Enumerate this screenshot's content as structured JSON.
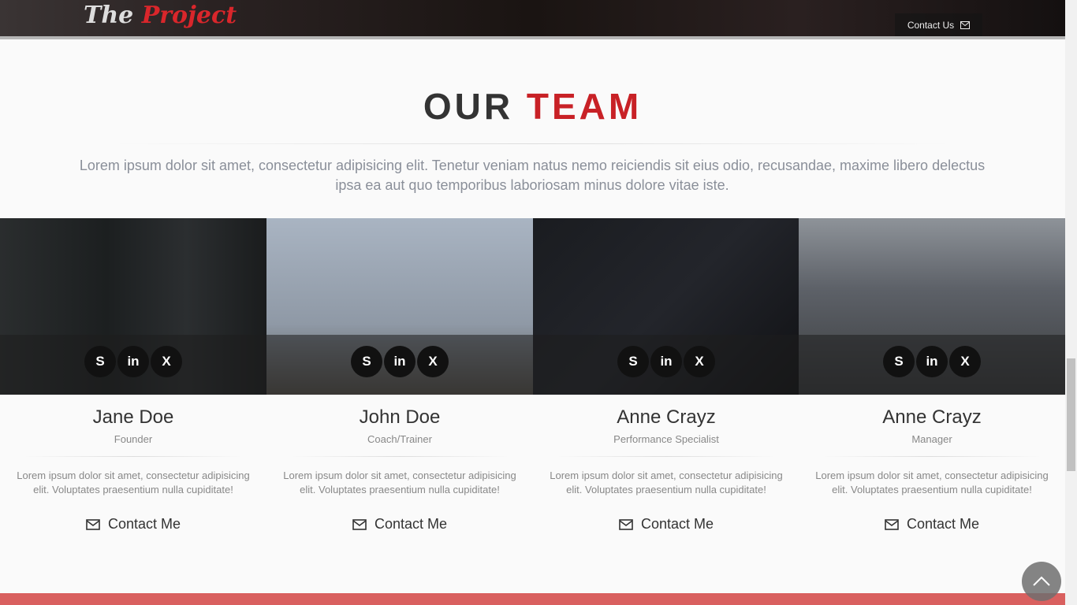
{
  "header": {
    "logo_part1": "The",
    "logo_part2": "Project",
    "contact_label": "Contact Us"
  },
  "section": {
    "title_part1": "OUR",
    "title_part2": "TEAM",
    "lead": "Lorem ipsum dolor sit amet, consectetur adipisicing elit. Tenetur veniam natus nemo reiciendis sit eius odio, recusandae, maxime libero delectus ipsa ea aut quo temporibus laboriosam minus dolore vitae iste."
  },
  "social": [
    "S",
    "in",
    "X"
  ],
  "members": [
    {
      "name": "Jane Doe",
      "role": "Founder",
      "desc": "Lorem ipsum dolor sit amet, consectetur adipisicing elit. Voluptates praesentium nulla cupiditate!",
      "contact": "Contact Me"
    },
    {
      "name": "John Doe",
      "role": "Coach/Trainer",
      "desc": "Lorem ipsum dolor sit amet, consectetur adipisicing elit. Voluptates praesentium nulla cupiditate!",
      "contact": "Contact Me"
    },
    {
      "name": "Anne Crayz",
      "role": "Performance Specialist",
      "desc": "Lorem ipsum dolor sit amet, consectetur adipisicing elit. Voluptates praesentium nulla cupiditate!",
      "contact": "Contact Me"
    },
    {
      "name": "Anne Crayz",
      "role": "Manager",
      "desc": "Lorem ipsum dolor sit amet, consectetur adipisicing elit. Voluptates praesentium nulla cupiditate!",
      "contact": "Contact Me"
    }
  ],
  "colors": {
    "accent": "#c82126",
    "footer": "#d9605f"
  }
}
